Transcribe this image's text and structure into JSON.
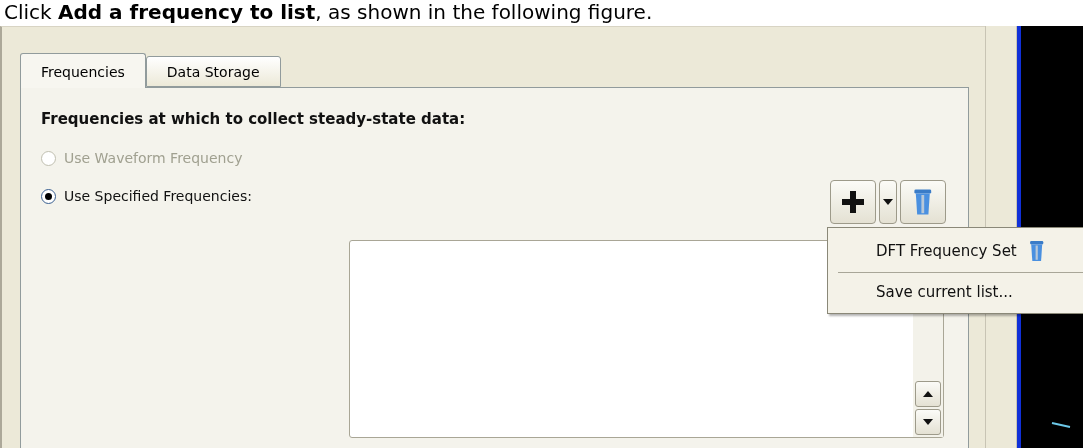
{
  "instruction": "Click **Add a frequency to list**, as shown in the following figure.",
  "tabs": [
    {
      "label": "Frequencies",
      "selected": true
    },
    {
      "label": "Data Storage",
      "selected": false
    }
  ],
  "heading": "Frequencies at which to collect steady-state data:",
  "options": [
    {
      "label": "Use Waveform Frequency",
      "selected": false,
      "disabled": true
    },
    {
      "label": "Use Specified Frequencies:",
      "selected": true,
      "disabled": false
    }
  ],
  "menu": {
    "items": [
      {
        "label": "DFT Frequency Set",
        "kind": "preset"
      },
      {
        "label": "Save current list...",
        "kind": "action"
      }
    ]
  }
}
